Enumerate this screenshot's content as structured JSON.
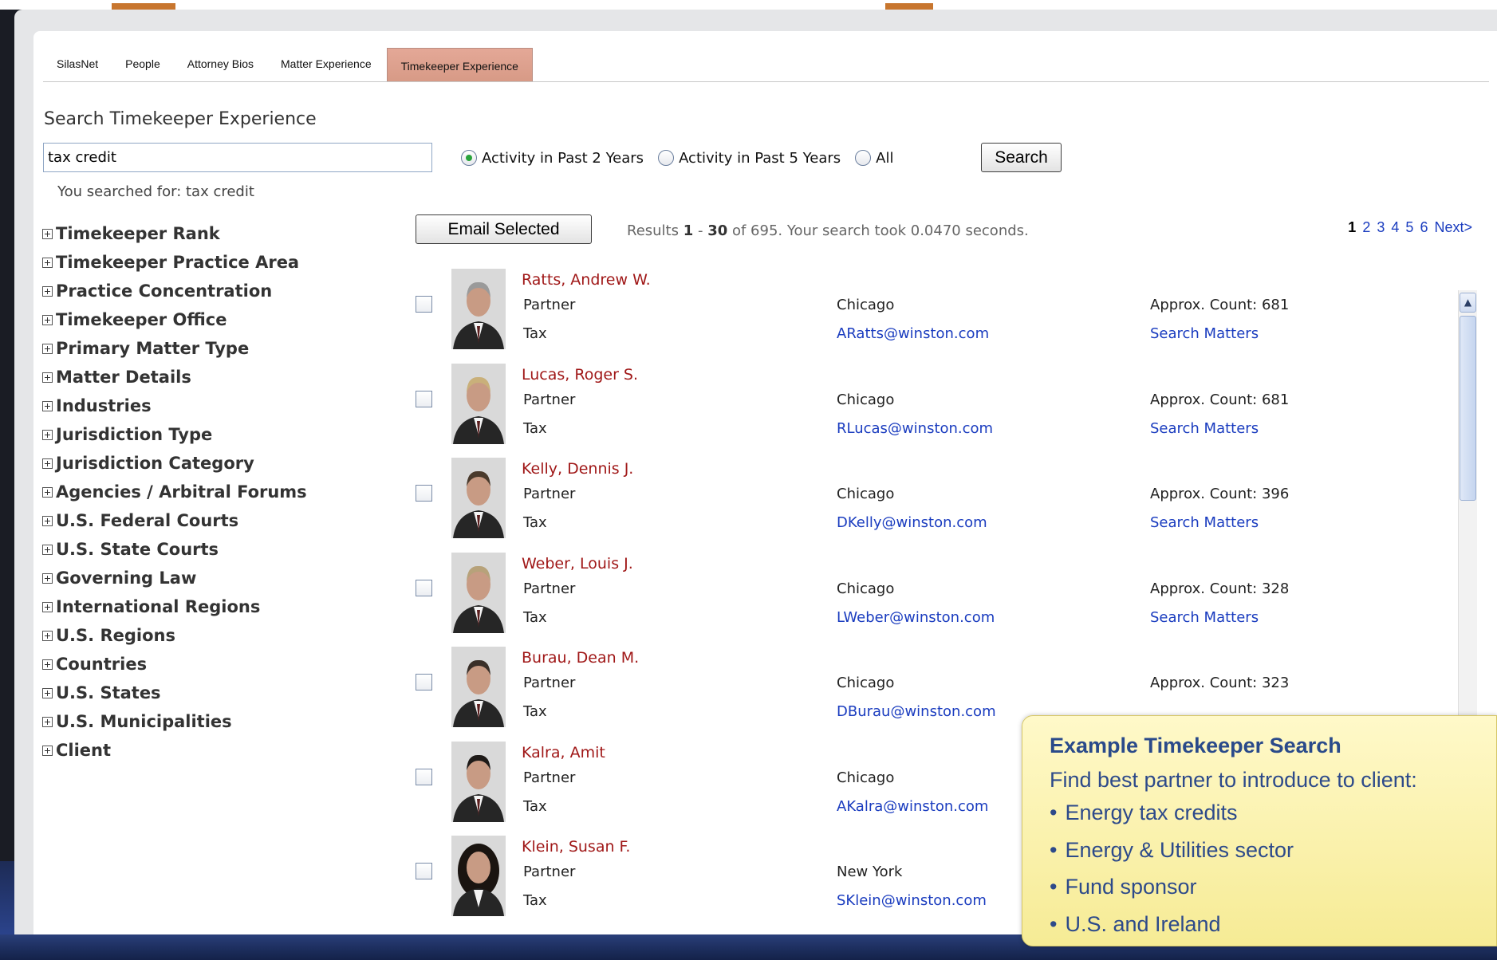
{
  "tabs": [
    {
      "label": "SilasNet"
    },
    {
      "label": "People"
    },
    {
      "label": "Attorney Bios"
    },
    {
      "label": "Matter Experience"
    },
    {
      "label": "Timekeeper Experience",
      "active": true
    }
  ],
  "search": {
    "title": "Search Timekeeper Experience",
    "query": "tax credit",
    "radios": [
      {
        "label": "Activity in Past 2 Years",
        "selected": true
      },
      {
        "label": "Activity in Past 5 Years",
        "selected": false
      },
      {
        "label": "All",
        "selected": false
      }
    ],
    "button_label": "Search",
    "searched_for": "You searched for: tax credit"
  },
  "facets": [
    "Timekeeper Rank",
    "Timekeeper Practice Area",
    "Practice Concentration",
    "Timekeeper Office",
    "Primary Matter Type",
    "Matter Details",
    "Industries",
    "Jurisdiction Type",
    "Jurisdiction Category",
    "Agencies / Arbitral Forums",
    "U.S. Federal Courts",
    "U.S. State Courts",
    "Governing Law",
    "International Regions",
    "U.S. Regions",
    "Countries",
    "U.S. States",
    "U.S. Municipalities",
    "Client"
  ],
  "toolbar": {
    "email_selected_label": "Email Selected",
    "results_prefix": "Results ",
    "results_from": "1",
    "results_sep": " - ",
    "results_to": "30",
    "results_suffix": " of 695. Your search took 0.0470 seconds."
  },
  "pager": {
    "current": "1",
    "pages": [
      "2",
      "3",
      "4",
      "5",
      "6"
    ],
    "next": "Next>"
  },
  "results": [
    {
      "name": "Ratts, Andrew W.",
      "title": "Partner",
      "dept": "Tax",
      "office": "Chicago",
      "email": "ARatts@winston.com",
      "count": "Approx. Count: 681",
      "matters": "Search Matters"
    },
    {
      "name": "Lucas, Roger S.",
      "title": "Partner",
      "dept": "Tax",
      "office": "Chicago",
      "email": "RLucas@winston.com",
      "count": "Approx. Count: 681",
      "matters": "Search Matters"
    },
    {
      "name": "Kelly, Dennis J.",
      "title": "Partner",
      "dept": "Tax",
      "office": "Chicago",
      "email": "DKelly@winston.com",
      "count": "Approx. Count: 396",
      "matters": "Search Matters"
    },
    {
      "name": "Weber, Louis J.",
      "title": "Partner",
      "dept": "Tax",
      "office": "Chicago",
      "email": "LWeber@winston.com",
      "count": "Approx. Count: 328",
      "matters": "Search Matters"
    },
    {
      "name": "Burau, Dean M.",
      "title": "Partner",
      "dept": "Tax",
      "office": "Chicago",
      "email": "DBurau@winston.com",
      "count": "Approx. Count: 323",
      "matters": ""
    },
    {
      "name": "Kalra, Amit",
      "title": "Partner",
      "dept": "Tax",
      "office": "Chicago",
      "email": "AKalra@winston.com",
      "count": "",
      "matters": ""
    },
    {
      "name": "Klein, Susan F.",
      "title": "Partner",
      "dept": "Tax",
      "office": "New York",
      "email": "SKlein@winston.com",
      "count": "",
      "matters": ""
    }
  ],
  "callout": {
    "title": "Example Timekeeper Search",
    "intro": "Find best partner to introduce to client:",
    "bullets": [
      "Energy tax credits",
      "Energy & Utilities sector",
      "Fund sponsor",
      "U.S. and Ireland"
    ]
  },
  "colors": {
    "name_link": "#a01818",
    "link": "#1a3cbf",
    "active_tab": "#d99c88",
    "callout_bg": "#fbf3b0",
    "callout_text": "#2d4a8a"
  }
}
